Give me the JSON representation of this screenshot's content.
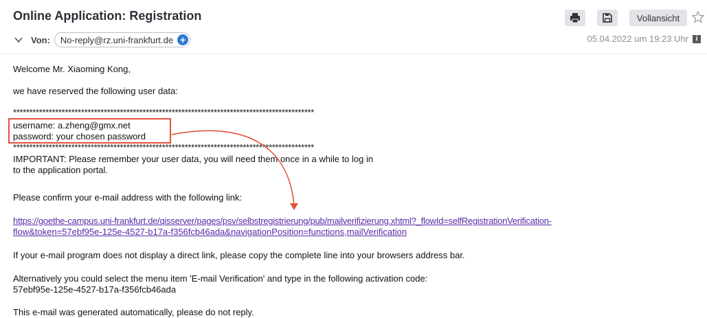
{
  "header": {
    "subject": "Online Application: Registration",
    "from_label": "Von:",
    "sender": "No-reply@rz.uni-frankfurt.de",
    "toolbar": {
      "full_view_label": "Vollansicht"
    },
    "date": "05.04.2022 um 19:23 Uhr"
  },
  "body": {
    "greeting": "Welcome Mr. Xiaoming Kong,",
    "reserved_line": "we have reserved the following user data:",
    "stars": "*********************************************************************************************",
    "username_line": "username: a.zheng@gmx.net",
    "password_line": "password: your chosen password",
    "important_line1": "IMPORTANT: Please remember your user data, you will need them once in a while to log in",
    "important_line2": "to the application portal.",
    "confirm_line": "Please confirm your e-mail address with the following link:",
    "link_line1": "https://goethe-campus.uni-frankfurt.de/qisserver/pages/psv/selbstregistrierung/pub/mailverifizierung.xhtml?_flowId=selfRegistrationVerification-",
    "link_line2": "flow&token=57ebf95e-125e-4527-b17a-f356fcb46ada&navigationPosition=functions,mailVerification",
    "no_link_line": "If your e-mail program does not display a direct link, please copy the complete line into your browsers address bar.",
    "alt_line1": "Alternatively you could select the menu item 'E-mail Verification' and type in the following activation code:",
    "alt_line2": "57ebf95e-125e-4527-b17a-f356fcb46ada",
    "auto_line": "This e-mail was generated automatically, please do not reply."
  },
  "colors": {
    "accent": "#e0533b",
    "link": "#5a2aa8",
    "chip_plus": "#2f78d8"
  },
  "icons": [
    "chevron-down-icon",
    "plus-circle-icon",
    "printer-icon",
    "save-icon",
    "star-icon",
    "info-icon"
  ]
}
